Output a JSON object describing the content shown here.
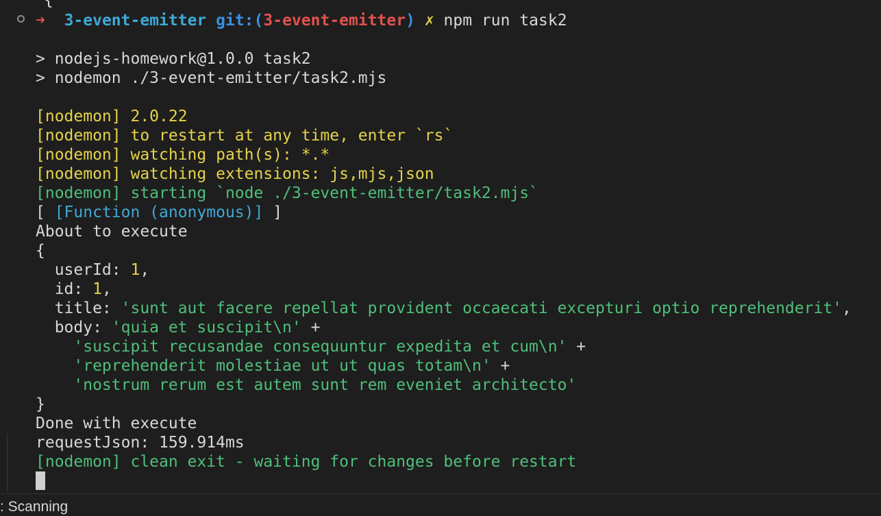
{
  "terminal": {
    "cut_line": "{",
    "prompt": {
      "arrow": "➜",
      "directory": "3-event-emitter",
      "git_label": "git:(",
      "branch": "3-event-emitter",
      "git_close": ")",
      "dirty_mark": "✗",
      "command": "npm run task2"
    },
    "script_header": [
      "> nodejs-homework@1.0.0 task2",
      "> nodemon ./3-event-emitter/task2.mjs"
    ],
    "nodemon_yellow": [
      "[nodemon] 2.0.22",
      "[nodemon] to restart at any time, enter `rs`",
      "[nodemon] watching path(s): *.*",
      "[nodemon] watching extensions: js,mjs,json"
    ],
    "nodemon_starting": "[nodemon] starting `node ./3-event-emitter/task2.mjs`",
    "function_line": {
      "open": "[ ",
      "value": "[Function (anonymous)]",
      "close": " ]"
    },
    "about": "About to execute",
    "obj_open": "{",
    "fields": {
      "userId_key": "  userId: ",
      "userId_val": "1",
      "id_key": "  id: ",
      "id_val": "1",
      "title_key": "  title: ",
      "title_val": "'sunt aut facere repellat provident occaecati excepturi optio reprehenderit'",
      "body_key": "  body: ",
      "body_1": "'quia et suscipit\\n'",
      "body_2": "'suscipit recusandae consequuntur expedita et cum\\n'",
      "body_3": "'reprehenderit molestiae ut ut quas totam\\n'",
      "body_4": "'nostrum rerum est autem sunt rem eveniet architecto'",
      "plus": " +",
      "comma": ","
    },
    "obj_close": "}",
    "done": "Done with execute",
    "timing": "requestJson: 159.914ms",
    "clean_exit": "[nodemon] clean exit - waiting for changes before restart"
  },
  "status_bar": {
    "text": ": Scanning"
  },
  "colors": {
    "background": "#1e1e1e",
    "foreground": "#d8d8d8",
    "yellow": "#e6d34a",
    "green": "#4fbf7a",
    "cyan": "#3fa9d6",
    "red": "#e0524d"
  }
}
